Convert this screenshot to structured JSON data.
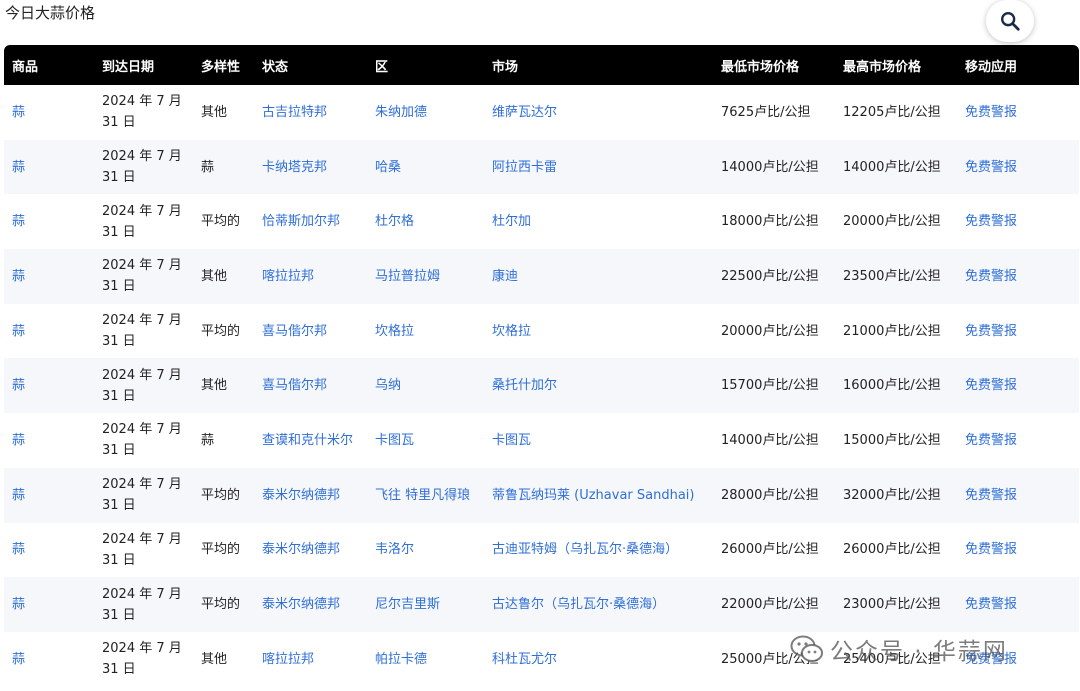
{
  "page": {
    "title": "今日大蒜价格",
    "search_icon": "search-icon"
  },
  "table": {
    "headers": [
      "商品",
      "到达日期",
      "多样性",
      "状态",
      "区",
      "市场",
      "最低市场价格",
      "最高市场价格",
      "移动应用"
    ],
    "rows": [
      {
        "commodity": "蒜",
        "date_line1": "2024 年 7 月",
        "date_line2": "31 日",
        "variety": "其他",
        "state": "古吉拉特邦",
        "district": "朱纳加德",
        "market": "维萨瓦达尔",
        "min_price": "7625卢比/公担",
        "max_price": "12205卢比/公担",
        "app": "免费警报"
      },
      {
        "commodity": "蒜",
        "date_line1": "2024 年 7 月",
        "date_line2": "31 日",
        "variety": "蒜",
        "state": "卡纳塔克邦",
        "district": "哈桑",
        "market": "阿拉西卡雷",
        "min_price": "14000卢比/公担",
        "max_price": "14000卢比/公担",
        "app": "免费警报"
      },
      {
        "commodity": "蒜",
        "date_line1": "2024 年 7 月",
        "date_line2": "31 日",
        "variety": "平均的",
        "state": "恰蒂斯加尔邦",
        "district": "杜尔格",
        "market": "杜尔加",
        "min_price": "18000卢比/公担",
        "max_price": "20000卢比/公担",
        "app": "免费警报"
      },
      {
        "commodity": "蒜",
        "date_line1": "2024 年 7 月",
        "date_line2": "31 日",
        "variety": "其他",
        "state": "喀拉拉邦",
        "district": "马拉普拉姆",
        "market": "康迪",
        "min_price": "22500卢比/公担",
        "max_price": "23500卢比/公担",
        "app": "免费警报"
      },
      {
        "commodity": "蒜",
        "date_line1": "2024 年 7 月",
        "date_line2": "31 日",
        "variety": "平均的",
        "state": "喜马偕尔邦",
        "district": "坎格拉",
        "market": "坎格拉",
        "min_price": "20000卢比/公担",
        "max_price": "21000卢比/公担",
        "app": "免费警报"
      },
      {
        "commodity": "蒜",
        "date_line1": "2024 年 7 月",
        "date_line2": "31 日",
        "variety": "其他",
        "state": "喜马偕尔邦",
        "district": "乌纳",
        "market": "桑托什加尔",
        "min_price": "15700卢比/公担",
        "max_price": "16000卢比/公担",
        "app": "免费警报"
      },
      {
        "commodity": "蒜",
        "date_line1": "2024 年 7 月",
        "date_line2": "31 日",
        "variety": "蒜",
        "state": "查谟和克什米尔",
        "district": "卡图瓦",
        "market": "卡图瓦",
        "min_price": "14000卢比/公担",
        "max_price": "15000卢比/公担",
        "app": "免费警报"
      },
      {
        "commodity": "蒜",
        "date_line1": "2024 年 7 月",
        "date_line2": "31 日",
        "variety": "平均的",
        "state": "泰米尔纳德邦",
        "district": "飞往 特里凡得琅",
        "market": "蒂鲁瓦纳玛莱 (Uzhavar Sandhai)",
        "min_price": "28000卢比/公担",
        "max_price": "32000卢比/公担",
        "app": "免费警报"
      },
      {
        "commodity": "蒜",
        "date_line1": "2024 年 7 月",
        "date_line2": "31 日",
        "variety": "平均的",
        "state": "泰米尔纳德邦",
        "district": "韦洛尔",
        "market": "古迪亚特姆（乌扎瓦尔·桑德海）",
        "min_price": "26000卢比/公担",
        "max_price": "26000卢比/公担",
        "app": "免费警报"
      },
      {
        "commodity": "蒜",
        "date_line1": "2024 年 7 月",
        "date_line2": "31 日",
        "variety": "平均的",
        "state": "泰米尔纳德邦",
        "district": "尼尔吉里斯",
        "market": "古达鲁尔（乌扎瓦尔·桑德海）",
        "min_price": "22000卢比/公担",
        "max_price": "23000卢比/公担",
        "app": "免费警报"
      },
      {
        "commodity": "蒜",
        "date_line1": "2024 年 7 月",
        "date_line2": "31 日",
        "variety": "其他",
        "state": "喀拉拉邦",
        "district": "帕拉卡德",
        "market": "科杜瓦尤尔",
        "min_price": "25000卢比/公担",
        "max_price": "25400卢比/公担",
        "app": "免费警报"
      }
    ]
  },
  "watermark": {
    "text": "公众号 · 华蒜网",
    "icon": "wechat-icon"
  }
}
